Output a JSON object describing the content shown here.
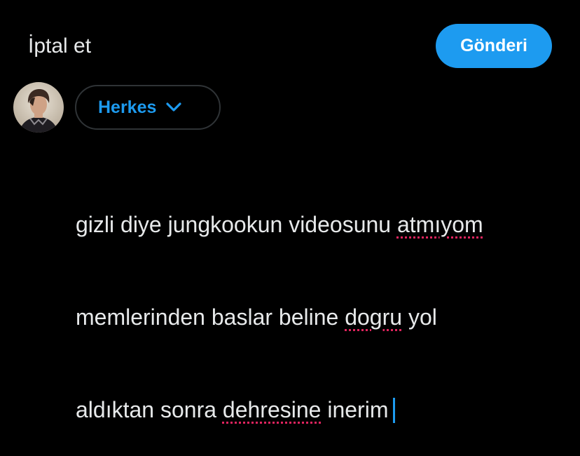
{
  "header": {
    "cancel_label": "İptal et",
    "send_label": "Gönderi"
  },
  "audience": {
    "label": "Herkes",
    "icon": "chevron-down-icon"
  },
  "composer": {
    "line1_a": "gizli diye jungkookun videosunu ",
    "line1_b": "atmıyom",
    "line2_a": "memlerinden baslar beline ",
    "line2_b": "dogru",
    "line2_c": " yol",
    "line3_a": "aldıktan sonra ",
    "line3_b": "dehresine",
    "line3_c": " inerim"
  },
  "colors": {
    "accent": "#1d9bf0",
    "background": "#000000",
    "text": "#e7e9ea",
    "spellcheck": "#e0245e"
  }
}
